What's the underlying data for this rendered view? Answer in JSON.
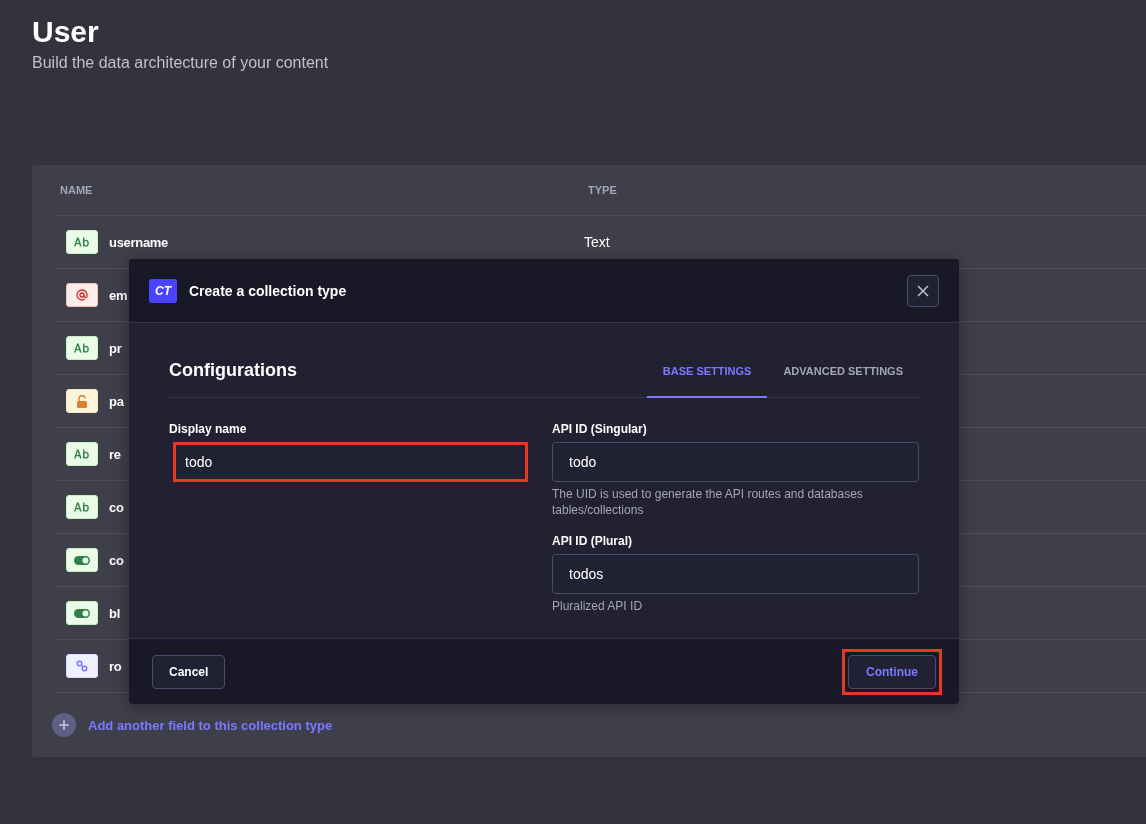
{
  "header": {
    "title": "User",
    "subtitle": "Build the data architecture of your content"
  },
  "table": {
    "columns": [
      "NAME",
      "TYPE"
    ],
    "rows": [
      {
        "kind": "text",
        "name": "username",
        "type": "Text"
      },
      {
        "kind": "email",
        "name": "em"
      },
      {
        "kind": "text",
        "name": "pr"
      },
      {
        "kind": "password",
        "name": "pa"
      },
      {
        "kind": "text",
        "name": "re"
      },
      {
        "kind": "text",
        "name": "co"
      },
      {
        "kind": "boolean",
        "name": "co"
      },
      {
        "kind": "boolean",
        "name": "bl"
      },
      {
        "kind": "relation",
        "name": "ro"
      }
    ],
    "add_field": "Add another field to this collection type"
  },
  "modal": {
    "badge": "CT",
    "title": "Create a collection type",
    "section_title": "Configurations",
    "tabs": [
      {
        "label": "BASE SETTINGS",
        "selected": true
      },
      {
        "label": "ADVANCED SETTINGS",
        "selected": false
      }
    ],
    "fields": [
      {
        "label": "Display name",
        "value": "todo",
        "highlighted": true
      },
      {
        "label": "API ID (Singular)",
        "value": "todo",
        "hint": "The UID is used to generate the API routes and databases tables/collections",
        "highlighted": false
      },
      {
        "label": "API ID (Plural)",
        "value": "todos",
        "hint": "Pluralized API ID",
        "highlighted": false
      }
    ],
    "cancel": {
      "label": "Cancel",
      "highlighted": false
    },
    "continue": {
      "label": "Continue",
      "highlighted": true
    }
  }
}
